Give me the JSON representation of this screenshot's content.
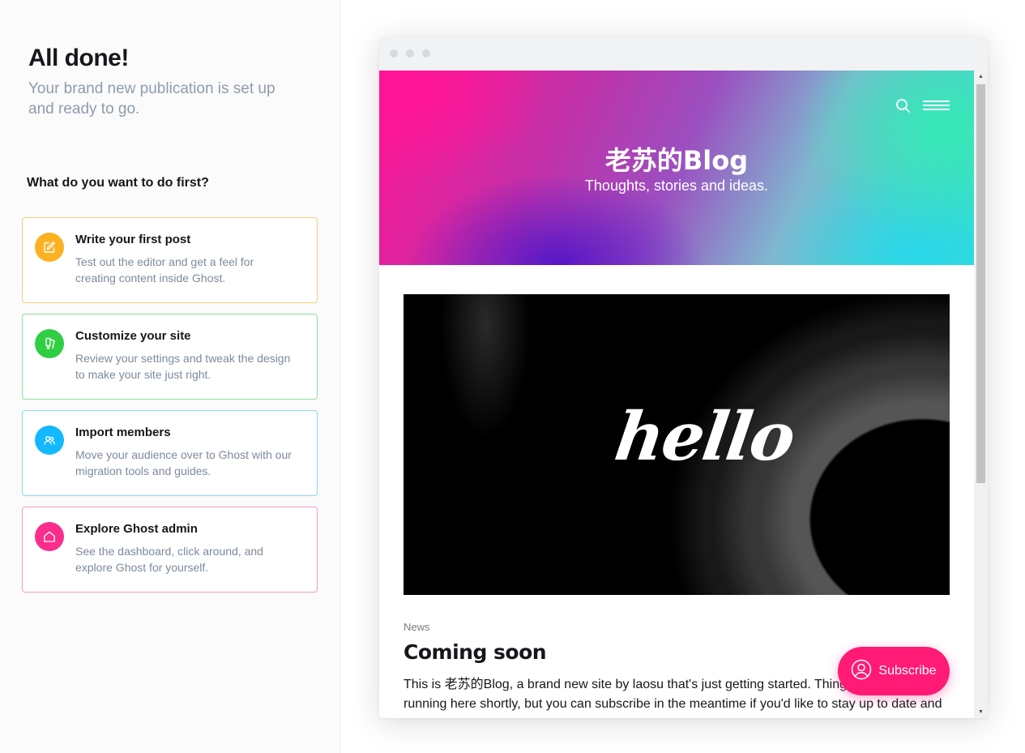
{
  "onboarding": {
    "title": "All done!",
    "subtitle": "Your brand new publication is set up and ready to go.",
    "question": "What do you want to do first?",
    "cards": [
      {
        "title": "Write your first post",
        "description": "Test out the editor and get a feel for creating content inside Ghost.",
        "icon": "pencil-icon",
        "color": "#fcb123"
      },
      {
        "title": "Customize your site",
        "description": "Review your settings and tweak the design to make your site just right.",
        "icon": "brush-icon",
        "color": "#30cf43"
      },
      {
        "title": "Import members",
        "description": "Move your audience over to Ghost with our migration tools and guides.",
        "icon": "members-icon",
        "color": "#14b8ff"
      },
      {
        "title": "Explore Ghost admin",
        "description": "See the dashboard, click around, and explore Ghost for yourself.",
        "icon": "home-icon",
        "color": "#fb2d8d"
      }
    ]
  },
  "preview": {
    "site_title": "老苏的Blog",
    "site_description": "Thoughts, stories and ideas.",
    "feature_image_text": "hello",
    "post": {
      "tag": "News",
      "title": "Coming soon",
      "excerpt_line1": "This is 老苏的Blog, a brand new site by laosu that's just getting started. Things will be up and",
      "excerpt_line2": "running here shortly, but you can subscribe in the meantime if you'd like to stay up to date and"
    },
    "subscribe_label": "Subscribe",
    "accent_color": "#ff1a75"
  }
}
